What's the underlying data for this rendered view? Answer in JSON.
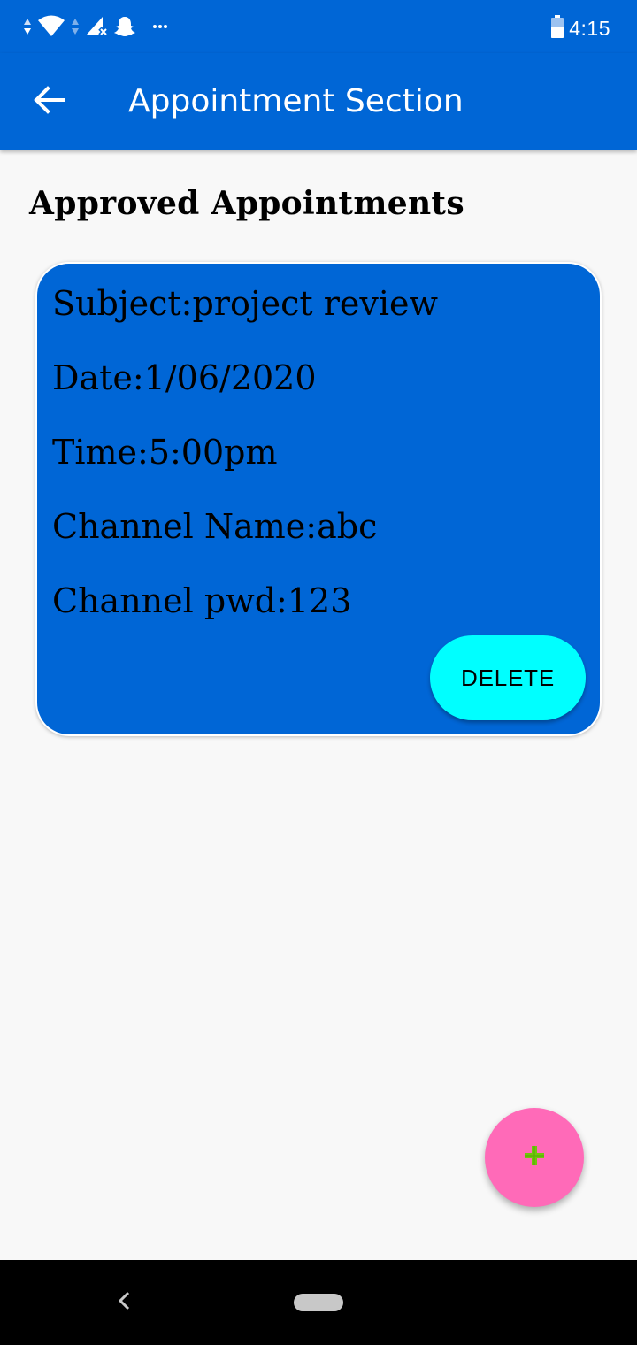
{
  "status_bar": {
    "time": "4:15",
    "icons": [
      "data-arrows-icon",
      "wifi-icon",
      "data-arrows-icon",
      "signal-off-icon",
      "snapchat-icon",
      "more-dots-icon",
      "battery-icon"
    ]
  },
  "app_bar": {
    "title": "Appointment Section",
    "back_icon": "arrow-back-icon"
  },
  "section": {
    "title": "Approved Appointments"
  },
  "appointment": {
    "subject": "Subject:project review",
    "date": "Date:1/06/2020",
    "time": "Time:5:00pm",
    "channel_name": "Channel Name:abc",
    "channel_pwd": "Channel pwd:123",
    "delete_label": "DELETE"
  },
  "fab": {
    "icon": "plus-icon"
  },
  "nav_bar": {
    "icons": [
      "nav-back-icon",
      "home-pill-icon"
    ]
  },
  "colors": {
    "primary": "#0066d6",
    "card": "#0066d6",
    "delete_button": "#00ffff",
    "fab": "#ff6ab8",
    "fab_icon": "#6fc70a",
    "background": "#f8f8f8"
  }
}
